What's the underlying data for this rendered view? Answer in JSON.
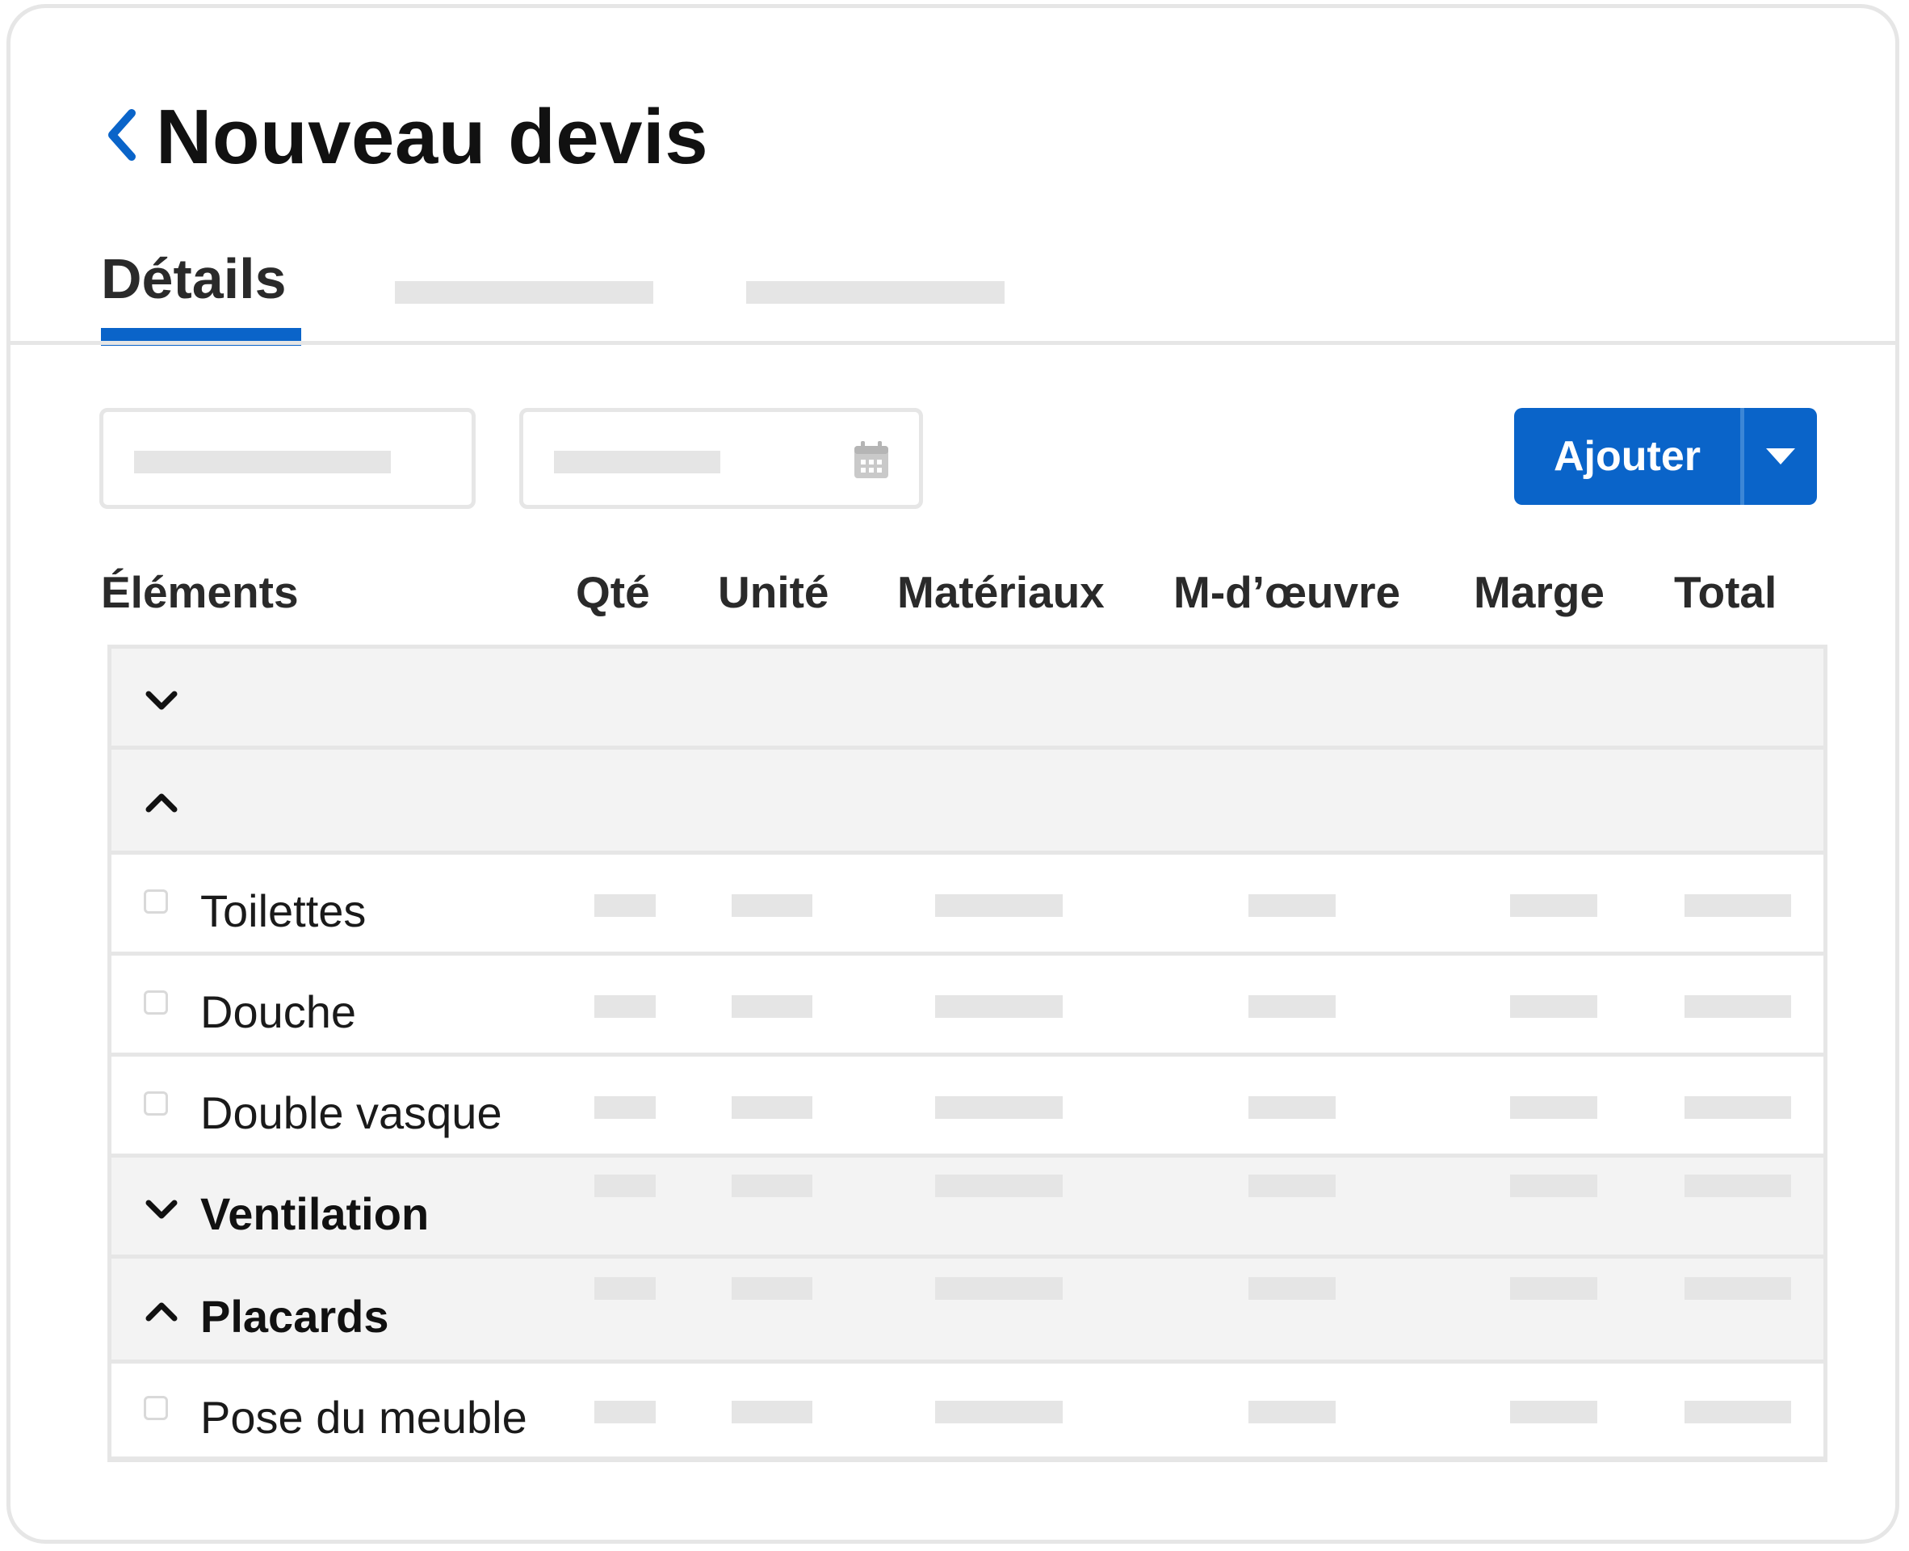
{
  "header": {
    "title": "Nouveau devis",
    "back_icon": "chevron-left-icon"
  },
  "tabs": [
    {
      "label": "Détails",
      "active": true
    },
    {
      "label": "",
      "active": false
    },
    {
      "label": "",
      "active": false
    }
  ],
  "toolbar": {
    "add_label": "Ajouter",
    "dropdown_icon": "caret-down-icon",
    "date_icon": "calendar-icon"
  },
  "columns": [
    "Éléments",
    "Qté",
    "Unité",
    "Matériaux",
    "M-d’œuvre",
    "Marge",
    "Total"
  ],
  "rows": [
    {
      "type": "group",
      "label": "",
      "expanded": false
    },
    {
      "type": "group",
      "label": "",
      "expanded": true
    },
    {
      "type": "item",
      "label": "Toilettes"
    },
    {
      "type": "item",
      "label": "Douche"
    },
    {
      "type": "item",
      "label": "Double vasque"
    },
    {
      "type": "group",
      "label": "Ventilation",
      "expanded": false
    },
    {
      "type": "group",
      "label": "Placards",
      "expanded": true
    },
    {
      "type": "item",
      "label": "Pose du meuble"
    }
  ],
  "colors": {
    "accent": "#0a64c9",
    "border": "#e6e6e6",
    "group_row_bg": "#f3f3f3",
    "placeholder": "#e5e5e5"
  }
}
